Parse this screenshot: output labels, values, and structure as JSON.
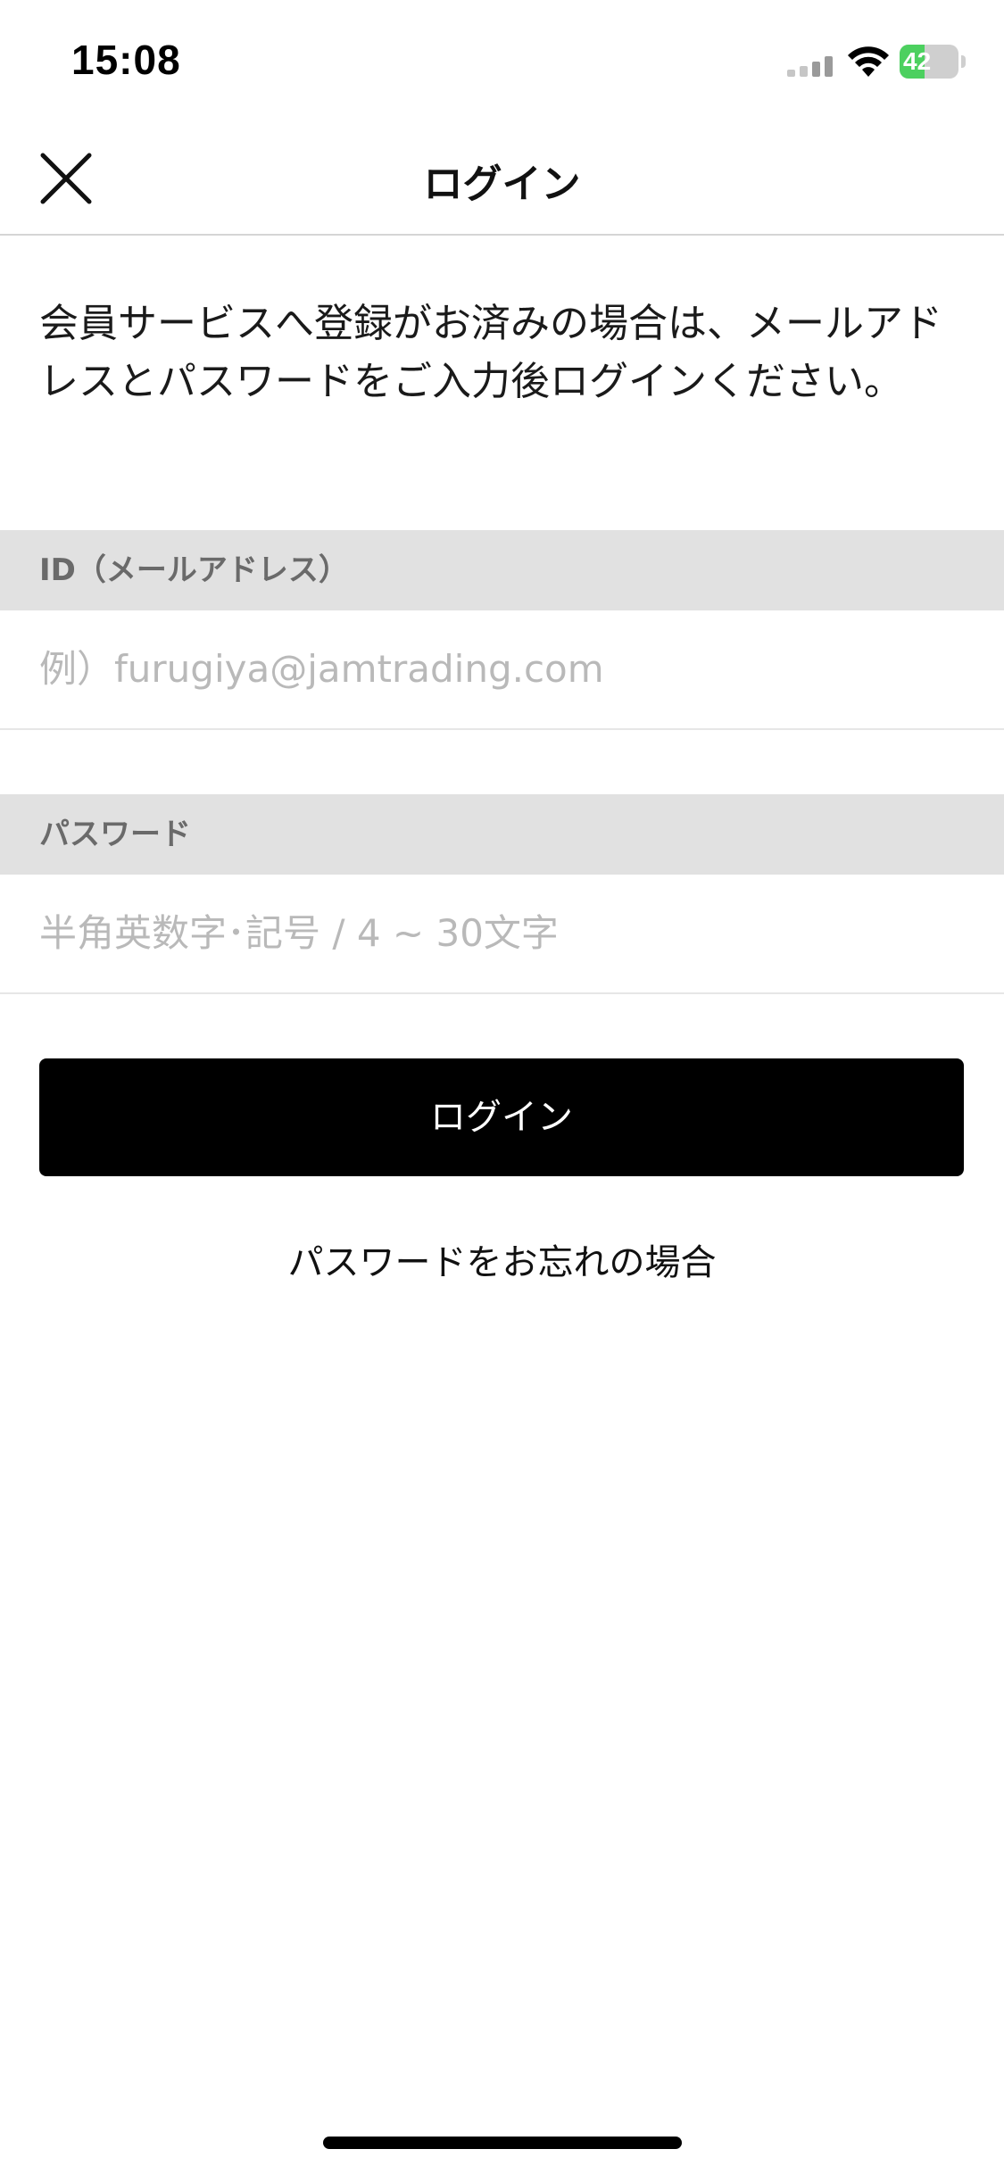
{
  "status_bar": {
    "time": "15:08",
    "battery_level": "42",
    "battery_fraction": 0.42,
    "battery_color": "#4cd05f",
    "icons": [
      "cellular-signal-icon",
      "wifi-icon",
      "battery-charging-icon"
    ]
  },
  "nav": {
    "title": "ログイン",
    "close_icon": "close-icon"
  },
  "intro": {
    "text": "会員サービスへ登録がお済みの場合は、メールアドレスとパスワードをご入力後ログインください。"
  },
  "form": {
    "id_label": "ID（メールアドレス）",
    "id_value": "",
    "id_placeholder": "例）furugiya@jamtrading.com",
    "password_label": "パスワード",
    "password_value": "",
    "password_placeholder": "半角英数字･記号 / 4 ~ 30文字"
  },
  "actions": {
    "login_label": "ログイン",
    "forgot_password_label": "パスワードをお忘れの場合"
  },
  "colors": {
    "accent": "#000000",
    "section_header_bg": "#e1e1e1"
  }
}
